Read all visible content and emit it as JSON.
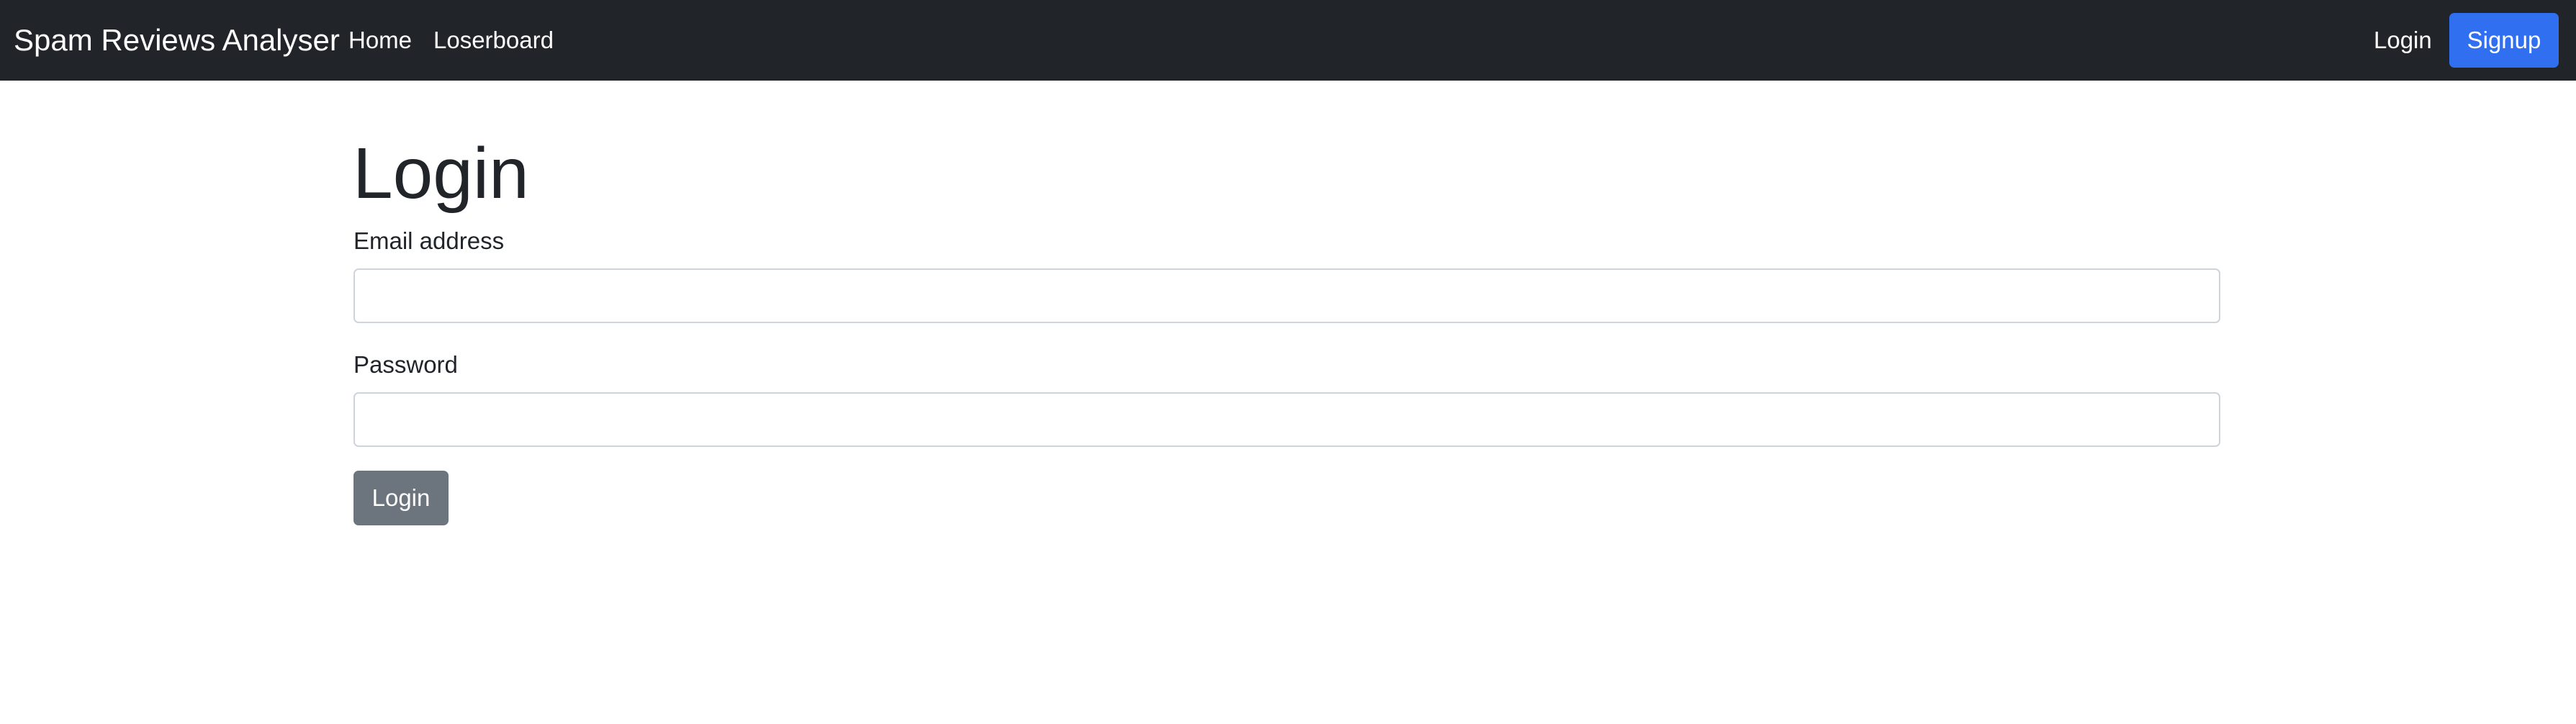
{
  "navbar": {
    "brand": "Spam Reviews Analyser",
    "links": [
      {
        "label": "Home"
      },
      {
        "label": "Loserboard"
      }
    ],
    "login_label": "Login",
    "signup_label": "Signup",
    "background_color": "#212529",
    "signup_color": "#2f6ff0"
  },
  "main": {
    "title": "Login",
    "email": {
      "label": "Email address",
      "value": "",
      "placeholder": ""
    },
    "password": {
      "label": "Password",
      "value": "",
      "placeholder": ""
    },
    "submit_label": "Login",
    "submit_color": "#6c757d"
  }
}
